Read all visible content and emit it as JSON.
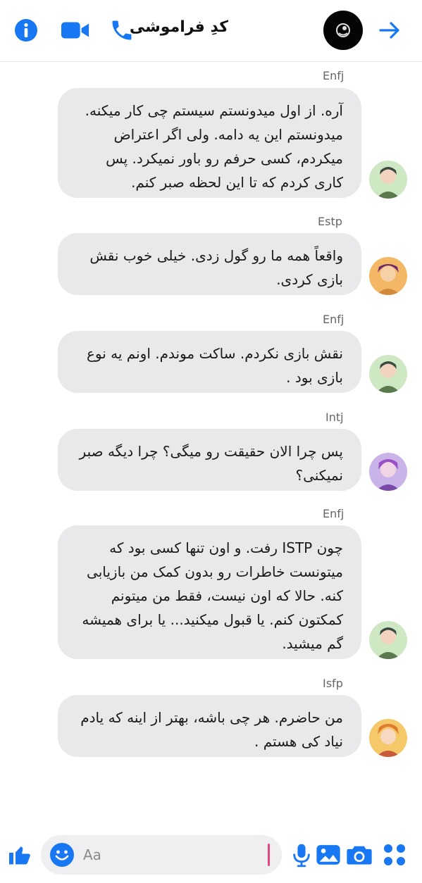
{
  "header": {
    "title": "کدِ فراموشی",
    "icons": [
      "info-icon",
      "video-call-icon",
      "phone-icon",
      "forward-arrow-icon"
    ],
    "accent": "#1877f2"
  },
  "messages": [
    {
      "sender": "Enfj",
      "text": "آره. از اول میدونستم سیستم چی کار میکنه. میدونستم این یه دامه. ولی اگر اعتراض میکردم، کسی حرفم رو باور نمیکرد. پس کاری کردم که تا این لحظه صبر کنم."
    },
    {
      "sender": "Estp",
      "text": "واقعاً همه ما رو گول زدی. خیلی خوب نقش بازی کردی."
    },
    {
      "sender": "Enfj",
      "text": "نقش بازی نکردم. ساکت موندم. اونم یه نوع بازی بود ."
    },
    {
      "sender": "Intj",
      "text": "پس چرا الان حقیقت رو میگی؟ چرا دیگه صبر نمیکنی؟"
    },
    {
      "sender": "Enfj",
      "text": "چون ISTP رفت. و اون تنها کسی بود که میتونست خاطرات رو بدون کمک من بازیابی کنه. حالا که اون نیست، فقط من میتونم کمکتون کنم. یا قبول میکنید... یا برای همیشه گم میشید."
    },
    {
      "sender": "Isfp",
      "text": "من حاضرم. هر چی باشه، بهتر از اینه که یادم نیاد کی هستم ."
    }
  ],
  "composer": {
    "placeholder": "Aa",
    "icons": [
      "thumbs-up-icon",
      "emoji-icon",
      "microphone-icon",
      "gallery-icon",
      "camera-icon",
      "apps-icon"
    ]
  }
}
